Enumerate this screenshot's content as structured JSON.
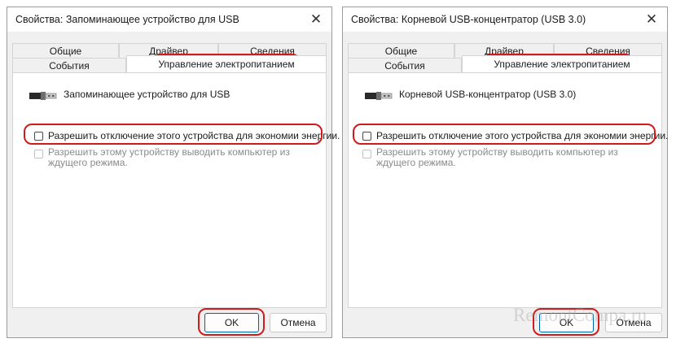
{
  "dialogs": [
    {
      "title": "Свойства: Запоминающее устройство для USB",
      "close_glyph": "✕",
      "tabs": {
        "general": "Общие",
        "driver": "Драйвер",
        "details": "Сведения",
        "events": "События",
        "power": "Управление электропитанием"
      },
      "device_name": "Запоминающее устройство для USB",
      "allow_off_checkbox": {
        "label": "Разрешить отключение этого устройства для экономии энергии.",
        "checked": false
      },
      "allow_wake_checkbox": {
        "label": "Разрешить этому устройству выводить компьютер из ждущего режима.",
        "checked": false,
        "enabled": false
      },
      "ok_label": "OK",
      "cancel_label": "Отмена"
    },
    {
      "title": "Свойства: Корневой USB-концентратор (USB 3.0)",
      "close_glyph": "✕",
      "tabs": {
        "general": "Общие",
        "driver": "Драйвер",
        "details": "Сведения",
        "events": "События",
        "power": "Управление электропитанием"
      },
      "device_name": "Корневой USB-концентратор (USB 3.0)",
      "allow_off_checkbox": {
        "label": "Разрешить отключение этого устройства для экономии энергии.",
        "checked": false
      },
      "allow_wake_checkbox": {
        "label": "Разрешить этому устройству выводить компьютер из ждущего режима.",
        "checked": false,
        "enabled": false
      },
      "ok_label": "OK",
      "cancel_label": "Отмена"
    }
  ],
  "icons": {
    "device": "usb-plug-icon",
    "close": "close-icon"
  },
  "colors": {
    "highlight": "#cf1b1b",
    "window_bg": "#f0f0f0",
    "panel_bg": "#ffffff"
  },
  "watermark": "RemontCompa.ru"
}
